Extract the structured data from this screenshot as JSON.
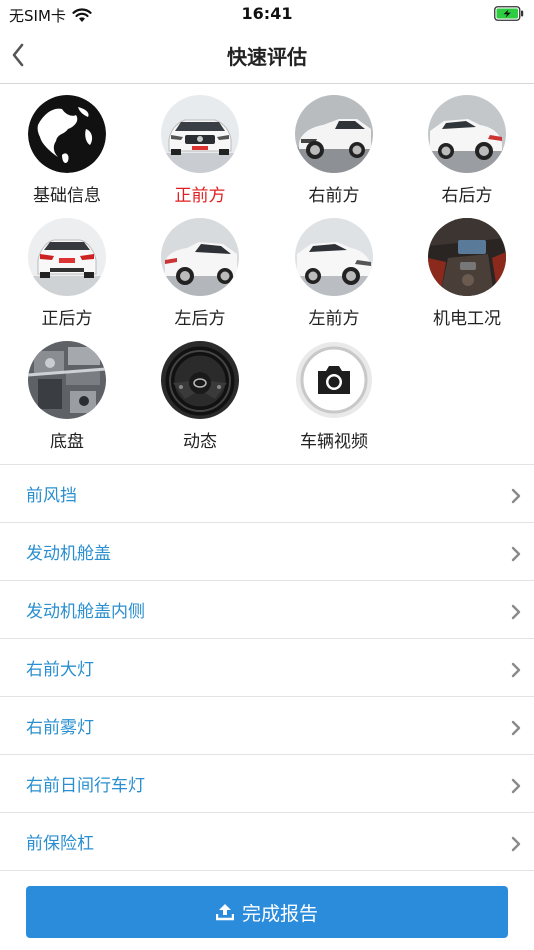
{
  "status_bar": {
    "carrier": "无SIM卡",
    "time": "16:41",
    "battery_color": "#2ecc40"
  },
  "nav": {
    "title": "快速评估",
    "back_icon": "chevron-left-icon"
  },
  "photo_items": [
    {
      "label": "基础信息",
      "icon": "globe-icon",
      "active": false
    },
    {
      "label": "正前方",
      "icon": "car-front-photo",
      "active": true
    },
    {
      "label": "右前方",
      "icon": "car-right-front-photo",
      "active": false
    },
    {
      "label": "右后方",
      "icon": "car-right-rear-photo",
      "active": false
    },
    {
      "label": "正后方",
      "icon": "car-rear-photo",
      "active": false
    },
    {
      "label": "左后方",
      "icon": "car-left-rear-photo",
      "active": false
    },
    {
      "label": "左前方",
      "icon": "car-left-front-photo",
      "active": false
    },
    {
      "label": "机电工况",
      "icon": "interior-photo",
      "active": false
    },
    {
      "label": "底盘",
      "icon": "chassis-photo",
      "active": false
    },
    {
      "label": "动态",
      "icon": "steering-wheel-photo",
      "active": false
    },
    {
      "label": "车辆视频",
      "icon": "camera-icon",
      "active": false
    }
  ],
  "inspection_items": [
    {
      "label": "前风挡"
    },
    {
      "label": "发动机舱盖"
    },
    {
      "label": "发动机舱盖内侧"
    },
    {
      "label": "右前大灯"
    },
    {
      "label": "右前雾灯"
    },
    {
      "label": "右前日间行车灯"
    },
    {
      "label": "前保险杠"
    }
  ],
  "footer": {
    "submit_label": "完成报告",
    "submit_icon": "upload-icon",
    "accent_color": "#2b8cdc"
  }
}
